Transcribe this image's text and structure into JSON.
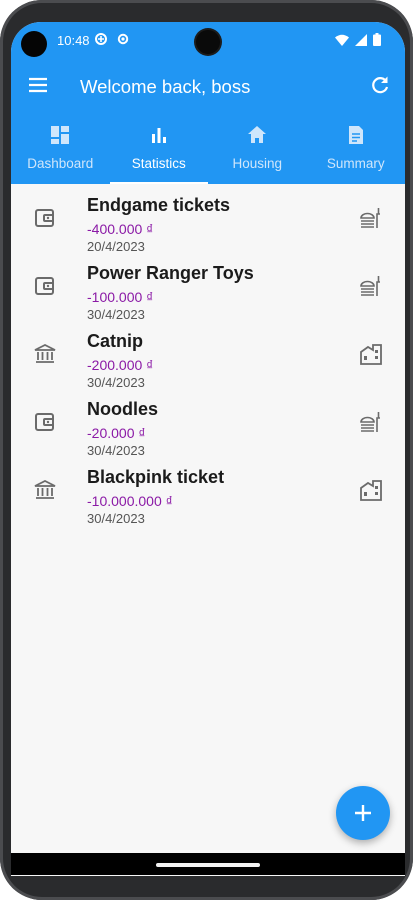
{
  "status_bar": {
    "time": "10:48"
  },
  "appbar": {
    "title": "Welcome back, boss",
    "menu_icon": "menu-icon",
    "refresh_icon": "refresh-icon"
  },
  "tabs": [
    {
      "label": "Dashboard",
      "icon": "dashboard-icon",
      "active": false
    },
    {
      "label": "Statistics",
      "icon": "bar-chart-icon",
      "active": true
    },
    {
      "label": "Housing",
      "icon": "home-icon",
      "active": false
    },
    {
      "label": "Summary",
      "icon": "document-icon",
      "active": false
    }
  ],
  "transactions": [
    {
      "name": "Endgame tickets",
      "amount": "-400.000 ₫",
      "date": "20/4/2023",
      "account_icon": "wallet-icon",
      "category_icon": "food-icon"
    },
    {
      "name": "Power Ranger Toys",
      "amount": "-100.000 ₫",
      "date": "30/4/2023",
      "account_icon": "wallet-icon",
      "category_icon": "food-icon"
    },
    {
      "name": "Catnip",
      "amount": "-200.000 ₫",
      "date": "30/4/2023",
      "account_icon": "bank-icon",
      "category_icon": "apartment-icon"
    },
    {
      "name": "Noodles",
      "amount": "-20.000 ₫",
      "date": "30/4/2023",
      "account_icon": "wallet-icon",
      "category_icon": "food-icon"
    },
    {
      "name": "Blackpink ticket",
      "amount": "-10.000.000 ₫",
      "date": "30/4/2023",
      "account_icon": "bank-icon",
      "category_icon": "apartment-icon"
    }
  ],
  "fab": {
    "icon": "plus-icon"
  },
  "colors": {
    "primary": "#2196f3",
    "amount": "#8b1aa6",
    "background": "#f7f7f7"
  }
}
